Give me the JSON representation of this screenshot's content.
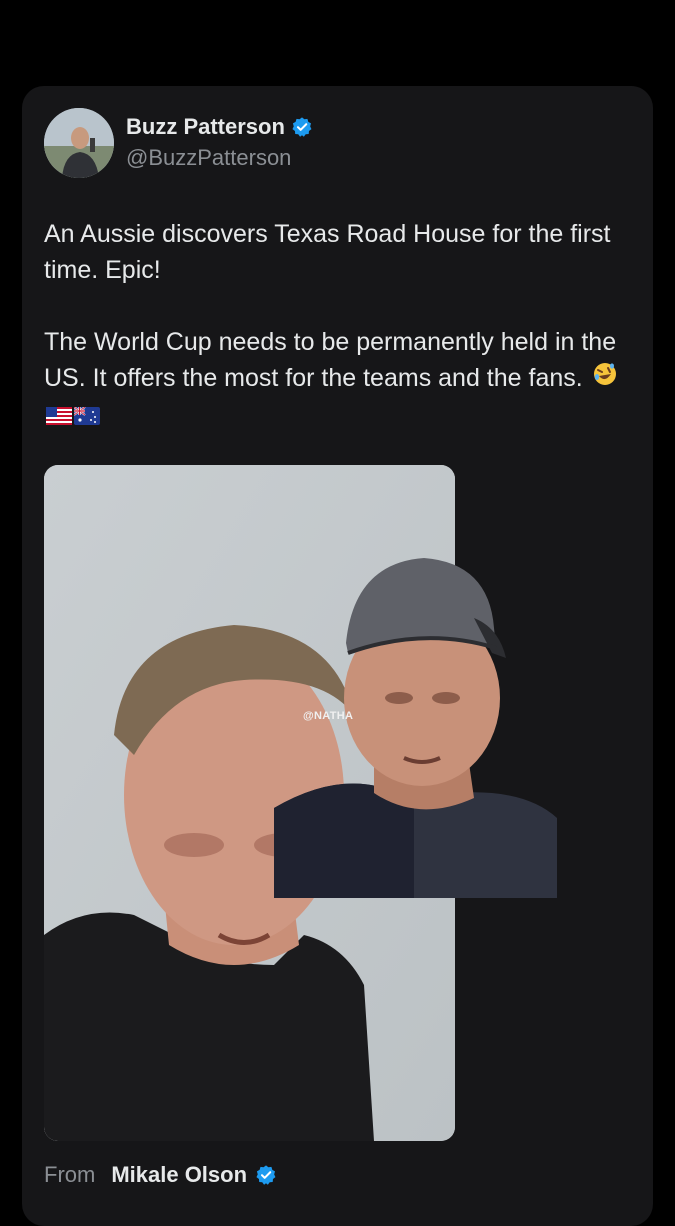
{
  "post": {
    "author_name": "Buzz Patterson",
    "author_handle": "@BuzzPatterson",
    "paragraph_1": "An Aussie discovers Texas Road House for the first time. Epic!",
    "paragraph_2": "The World Cup needs to be permanently held in the US. It offers the most for the teams and the fans.",
    "emojis": [
      "rolling-on-floor-laughing-emoji",
      "us-flag-emoji",
      "australia-flag-emoji"
    ]
  },
  "media": {
    "watermark": "@NATHA"
  },
  "attribution": {
    "from_label": "From",
    "source_name": "Mikale Olson"
  },
  "colors": {
    "background": "#000000",
    "card": "#161618",
    "text_primary": "#e7e9ea",
    "text_secondary": "#8b8f94",
    "verified_blue": "#1d9bf0"
  }
}
